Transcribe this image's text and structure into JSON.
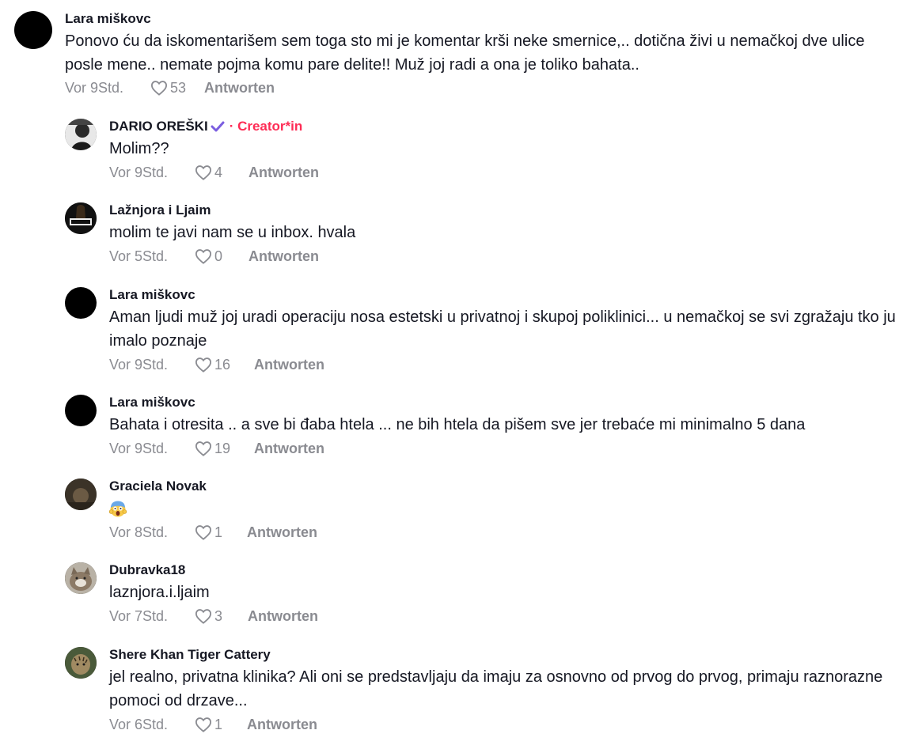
{
  "comments": [
    {
      "user": "Lara miškovc",
      "text": "Ponovo ću da iskomentarišem sem toga sto mi je komentar krši neke smernice,.. dotična živi u nemačkoj dve ulice posle mene.. nemate pojma komu pare delite!! Muž joj radi a ona je toliko bahata..",
      "time": "Vor 9Std.",
      "likes": "53",
      "reply": "Antworten",
      "avatar": "black"
    }
  ],
  "replies": [
    {
      "user": "DARIO OREŠKI",
      "badge": "· Creator*in",
      "text": "Molim??",
      "time": "Vor 9Std.",
      "likes": "4",
      "reply": "Antworten",
      "avatar": "photo-man"
    },
    {
      "user": "Lažnjora i Ljaim",
      "text": "molim te javi nam se u inbox. hvala",
      "time": "Vor 5Std.",
      "likes": "0",
      "reply": "Antworten",
      "avatar": "logo-dark"
    },
    {
      "user": "Lara miškovc",
      "text": "Aman ljudi muž joj uradi operaciju nosa estetski u privatnoj i skupoj poliklinici... u nemačkoj se svi zgražaju tko ju imalo poznaje",
      "time": "Vor 9Std.",
      "likes": "16",
      "reply": "Antworten",
      "avatar": "black"
    },
    {
      "user": "Lara miškovc",
      "text": "Bahata i otresita .. a sve bi đaba htela ... ne bih htela da pišem sve jer trebaće mi minimalno 5 dana",
      "time": "Vor 9Std.",
      "likes": "19",
      "reply": "Antworten",
      "avatar": "black"
    },
    {
      "user": "Graciela Novak",
      "text": "",
      "emoji": "screaming-face-emoji",
      "time": "Vor 8Std.",
      "likes": "1",
      "reply": "Antworten",
      "avatar": "photo-dark"
    },
    {
      "user": "Dubravka18",
      "text": "laznjora.i.ljaim",
      "time": "Vor 7Std.",
      "likes": "3",
      "reply": "Antworten",
      "avatar": "photo-cat"
    },
    {
      "user": "Shere Khan Tiger Cattery",
      "text": "jel realno, privatna klinika? Ali oni se predstavljaju da imaju za osnovno od prvog do prvog, primaju raznorazne pomoci od drzave...",
      "time": "Vor 6Std.",
      "likes": "1",
      "reply": "Antworten",
      "avatar": "photo-cat2"
    }
  ],
  "icons": {
    "like": "heart-outline-icon",
    "verified": "checkmark-icon"
  },
  "colors": {
    "creator": "#fe2c55",
    "verified": "#7b5ee0",
    "meta": "#8a8b91"
  }
}
